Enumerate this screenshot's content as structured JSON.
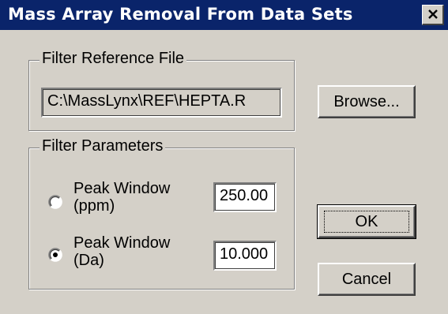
{
  "window": {
    "title": "Mass Array Removal From Data Sets"
  },
  "reference_group": {
    "label": "Filter Reference File",
    "file_value": "C:\\MassLynx\\REF\\HEPTA.R",
    "browse_label": "Browse..."
  },
  "parameters_group": {
    "label": "Filter Parameters",
    "options": [
      {
        "line1": "Peak Window",
        "line2": "(ppm)",
        "value": "250.00",
        "selected": false
      },
      {
        "line1": "Peak Window",
        "line2": "(Da)",
        "value": "10.000",
        "selected": true
      }
    ]
  },
  "buttons": {
    "ok_label": "OK",
    "cancel_label": "Cancel"
  },
  "colors": {
    "title_bar": "#0a246a",
    "face": "#d4d0c8"
  }
}
